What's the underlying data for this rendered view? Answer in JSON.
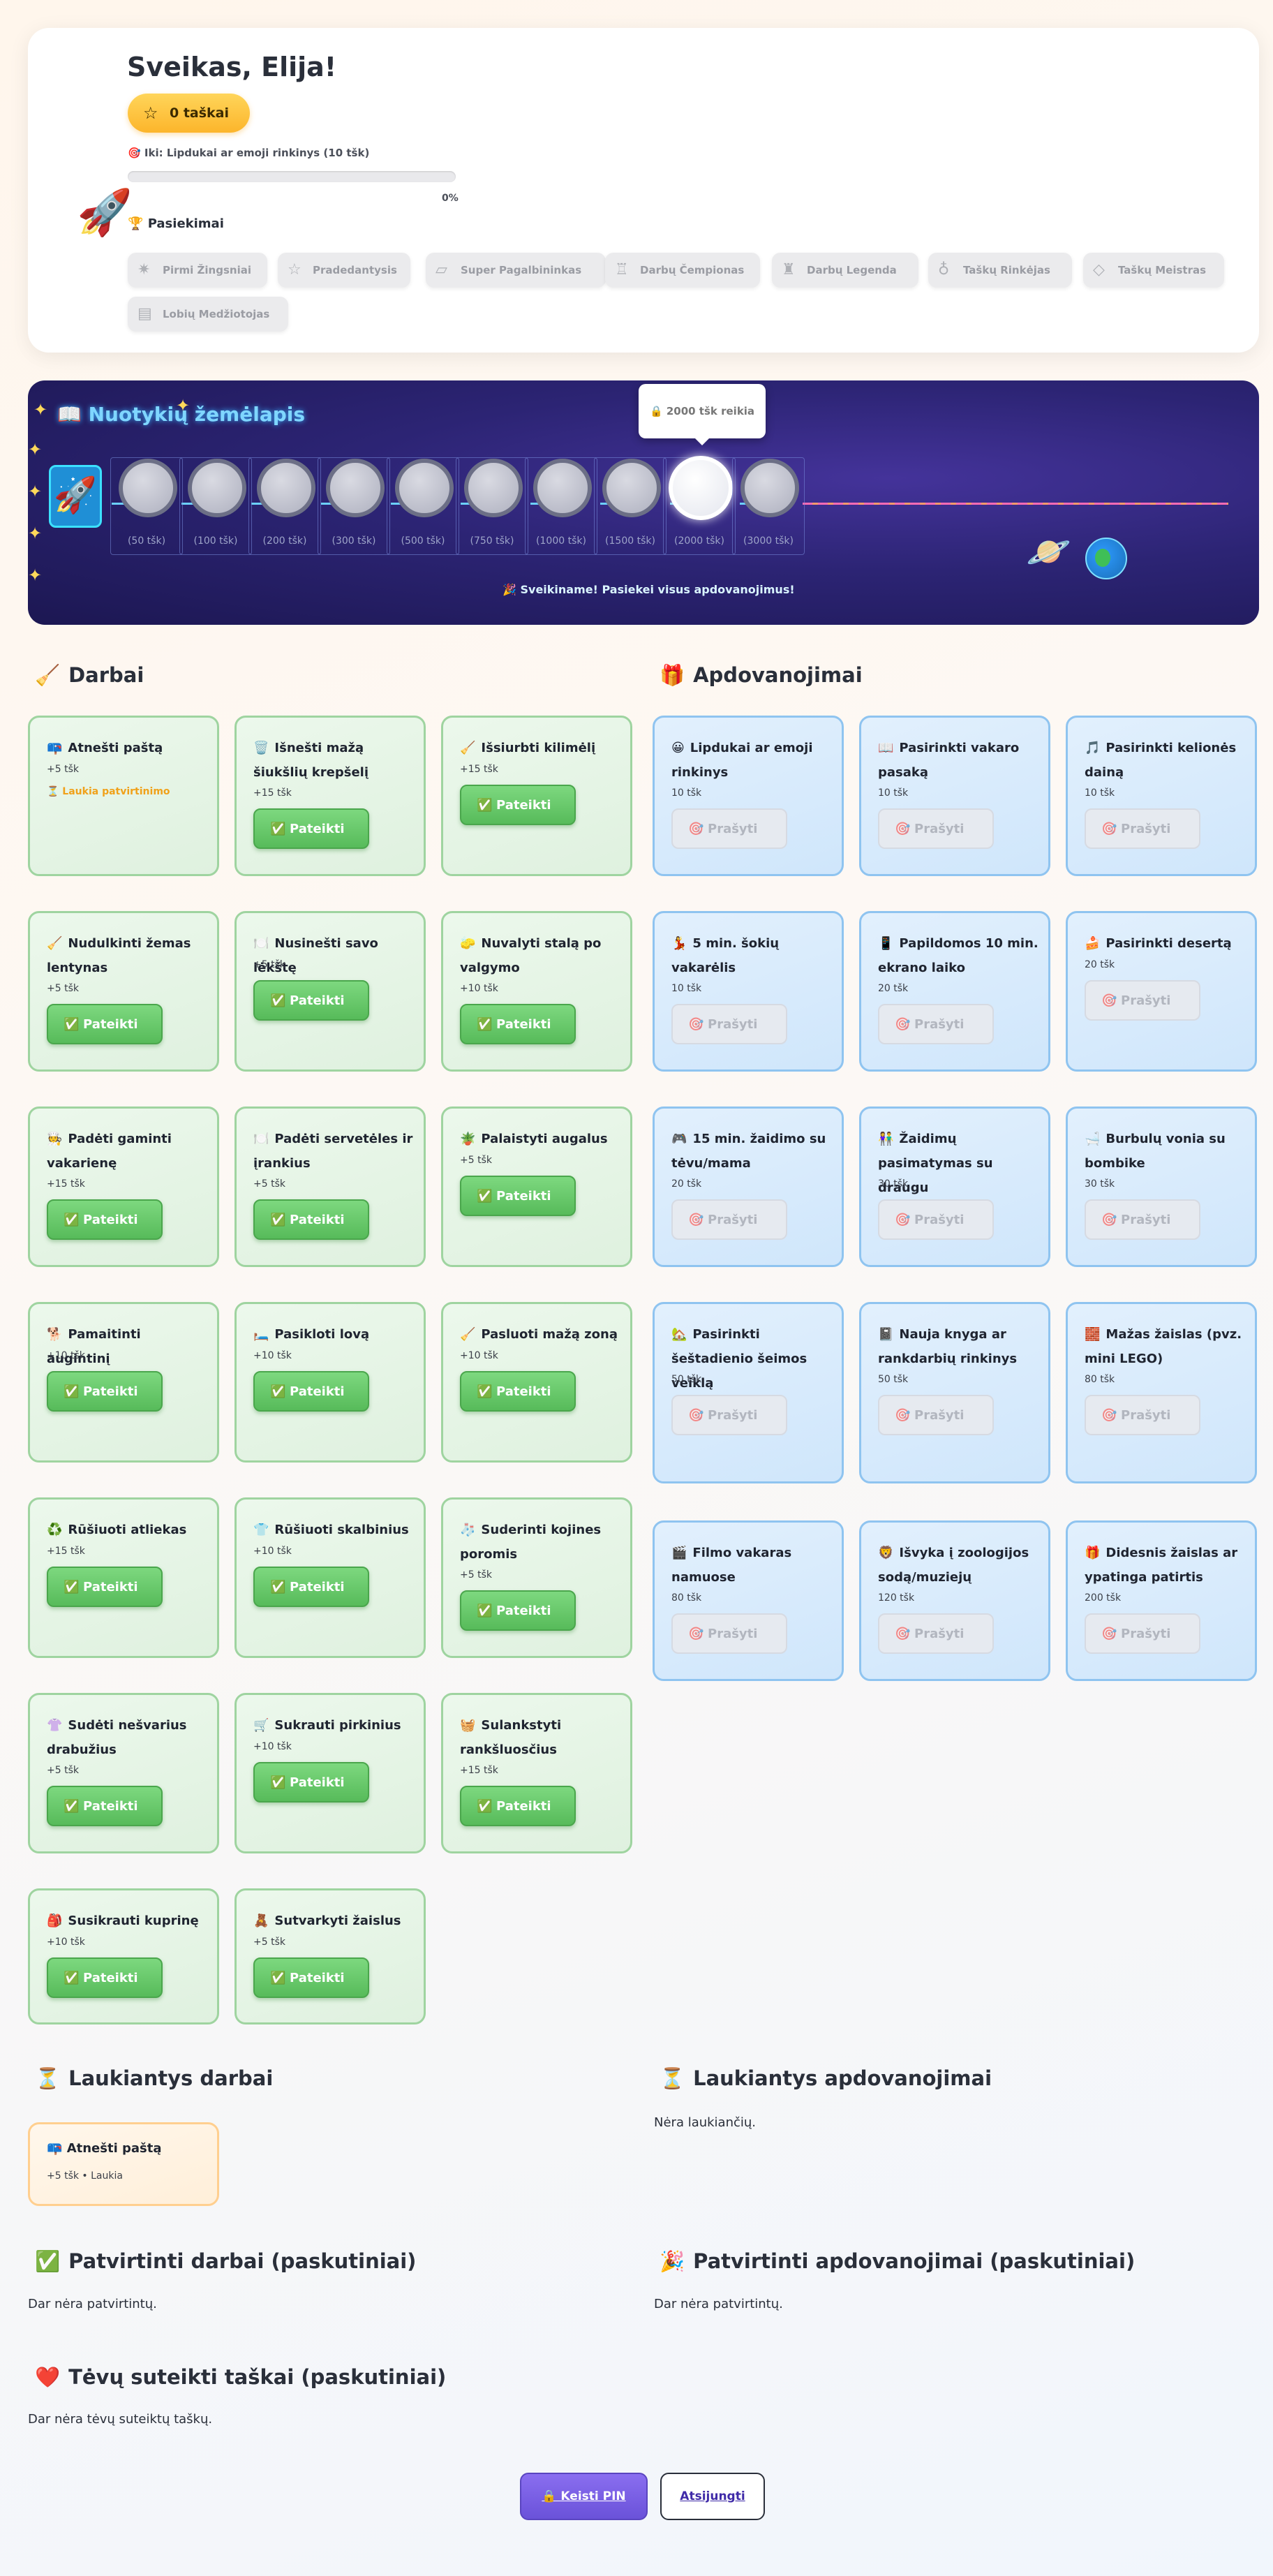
{
  "profile": {
    "greeting": "Sveikas, Elija!",
    "avatar_icon": "rocket-icon",
    "points_label": "0 taškai",
    "goal_label": "🎯 Iki: Lipdukai ar emoji rinkinys (10 tšk)",
    "progress_percent": 0,
    "progress_text": "0%",
    "achievements_title": "Pasiekimai",
    "achievements": [
      {
        "label": "Pirmi Žingsniai",
        "icon": "sparkle-icon"
      },
      {
        "label": "Pradedantysis",
        "icon": "star-icon"
      },
      {
        "label": "Super Pagalbininkas",
        "icon": "bandage-icon"
      },
      {
        "label": "Darbų Čempionas",
        "icon": "trophy-icon"
      },
      {
        "label": "Darbų Legenda",
        "icon": "castle-icon"
      },
      {
        "label": "Taškų Rinkėjas",
        "icon": "moneybag-icon"
      },
      {
        "label": "Taškų Meistras",
        "icon": "gem-icon"
      },
      {
        "label": "Lobių Medžiotojas",
        "icon": "map-icon"
      }
    ]
  },
  "map": {
    "title": "Nuotykių žemėlapis",
    "milestones": [
      "(50 tšk)",
      "(100 tšk)",
      "(200 tšk)",
      "(300 tšk)",
      "(500 tšk)",
      "(750 tšk)",
      "(1000 tšk)",
      "(1500 tšk)",
      "(2000 tšk)",
      "(3000 tšk)"
    ],
    "active_index": 8,
    "tooltip": "🔒 2000 tšk reikia",
    "congrats": "🎉 Sveikiname! Pasiekei visus apdovanojimus!"
  },
  "tasks": {
    "title": "Darbai",
    "submit_label": "Pateikti",
    "items": [
      {
        "icon": "📪",
        "name": "Atnešti paštą",
        "points": "+5 tšk",
        "status": "⏳ Laukia patvirtinimo"
      },
      {
        "icon": "🗑️",
        "name": "Išnešti mažą šiukšlių krepšelį",
        "points": "+15 tšk"
      },
      {
        "icon": "🧹",
        "name": "Išsiurbti kilimėlį",
        "points": "+15 tšk"
      },
      {
        "icon": "🧹",
        "name": "Nudulkinti žemas lentynas",
        "points": "+5 tšk"
      },
      {
        "icon": "🍽️",
        "name": "Nusinešti savo lėkštę",
        "points": "+5 tšk"
      },
      {
        "icon": "🧽",
        "name": "Nuvalyti stalą po valgymo",
        "points": "+10 tšk"
      },
      {
        "icon": "🧑‍🍳",
        "name": "Padėti gaminti vakarienę",
        "points": "+15 tšk"
      },
      {
        "icon": "🍽️",
        "name": "Padėti servetėles ir įrankius",
        "points": "+5 tšk"
      },
      {
        "icon": "🪴",
        "name": "Palaistyti augalus",
        "points": "+5 tšk"
      },
      {
        "icon": "🐕",
        "name": "Pamaitinti augintinį",
        "points": "+10 tšk"
      },
      {
        "icon": "🛏️",
        "name": "Pasikloti lovą",
        "points": "+10 tšk"
      },
      {
        "icon": "🧹",
        "name": "Pasluoti mažą zoną",
        "points": "+10 tšk"
      },
      {
        "icon": "♻️",
        "name": "Rūšiuoti atliekas",
        "points": "+15 tšk"
      },
      {
        "icon": "👕",
        "name": "Rūšiuoti skalbinius",
        "points": "+10 tšk"
      },
      {
        "icon": "🧦",
        "name": "Suderinti kojines poromis",
        "points": "+5 tšk"
      },
      {
        "icon": "👚",
        "name": "Sudėti nešvarius drabužius",
        "points": "+5 tšk"
      },
      {
        "icon": "🛒",
        "name": "Sukrauti pirkinius",
        "points": "+10 tšk"
      },
      {
        "icon": "🧺",
        "name": "Sulankstyti rankšluosčius",
        "points": "+15 tšk"
      },
      {
        "icon": "🎒",
        "name": "Susikrauti kuprinę",
        "points": "+10 tšk"
      },
      {
        "icon": "🧸",
        "name": "Sutvarkyti žaislus",
        "points": "+5 tšk"
      }
    ]
  },
  "rewards": {
    "title": "Apdovanojimai",
    "request_label": "Prašyti",
    "items": [
      {
        "icon": "😀",
        "name": "Lipdukai ar emoji rinkinys",
        "points": "10 tšk"
      },
      {
        "icon": "📖",
        "name": "Pasirinkti vakaro pasaką",
        "points": "10 tšk"
      },
      {
        "icon": "🎵",
        "name": "Pasirinkti kelionės dainą",
        "points": "10 tšk"
      },
      {
        "icon": "💃",
        "name": "5 min. šokių vakarėlis",
        "points": "10 tšk"
      },
      {
        "icon": "📱",
        "name": "Papildomos 10 min. ekrano laiko",
        "points": "20 tšk"
      },
      {
        "icon": "🍰",
        "name": "Pasirinkti desertą",
        "points": "20 tšk"
      },
      {
        "icon": "🎮",
        "name": "15 min. žaidimo su tėvu/mama",
        "points": "20 tšk"
      },
      {
        "icon": "👫",
        "name": "Žaidimų pasimatymas su draugu",
        "points": "30 tšk"
      },
      {
        "icon": "🛁",
        "name": "Burbulų vonia su bombike",
        "points": "30 tšk"
      },
      {
        "icon": "🏡",
        "name": "Pasirinkti šeštadienio šeimos veiklą",
        "points": "50 tšk"
      },
      {
        "icon": "📓",
        "name": "Nauja knyga ar rankdarbių rinkinys",
        "points": "50 tšk"
      },
      {
        "icon": "🧱",
        "name": "Mažas žaislas (pvz. mini LEGO)",
        "points": "80 tšk"
      },
      {
        "icon": "🎬",
        "name": "Filmo vakaras namuose",
        "points": "80 tšk"
      },
      {
        "icon": "🦁",
        "name": "Išvyka į zoologijos sodą/muziejų",
        "points": "120 tšk"
      },
      {
        "icon": "🎁",
        "name": "Didesnis žaislas ar ypatinga patirtis",
        "points": "200 tšk"
      }
    ]
  },
  "pending_tasks": {
    "title": "Laukiantys darbai",
    "items": [
      {
        "icon": "📪",
        "name": "Atnešti paštą",
        "meta": "+5 tšk • Laukia"
      }
    ]
  },
  "pending_rewards": {
    "title": "Laukiantys apdovanojimai",
    "empty": "Nėra laukiančių."
  },
  "approved_tasks": {
    "title": "Patvirtinti darbai (paskutiniai)",
    "empty": "Dar nėra patvirtintų."
  },
  "approved_rewards": {
    "title": "Patvirtinti apdovanojimai (paskutiniai)",
    "empty": "Dar nėra patvirtintų."
  },
  "parent_points": {
    "title": "Tėvų suteikti taškai (paskutiniai)",
    "empty": "Dar nėra tėvų suteiktų taškų."
  },
  "footer": {
    "pin_label": "🔒 Keisti PIN",
    "logout_label": "Atsijungti"
  },
  "colors": {
    "task_green": "#57bb5a",
    "reward_blue": "#8fc4f0",
    "points_gold": "#fcb52b",
    "map_bg": "#2c2474"
  }
}
